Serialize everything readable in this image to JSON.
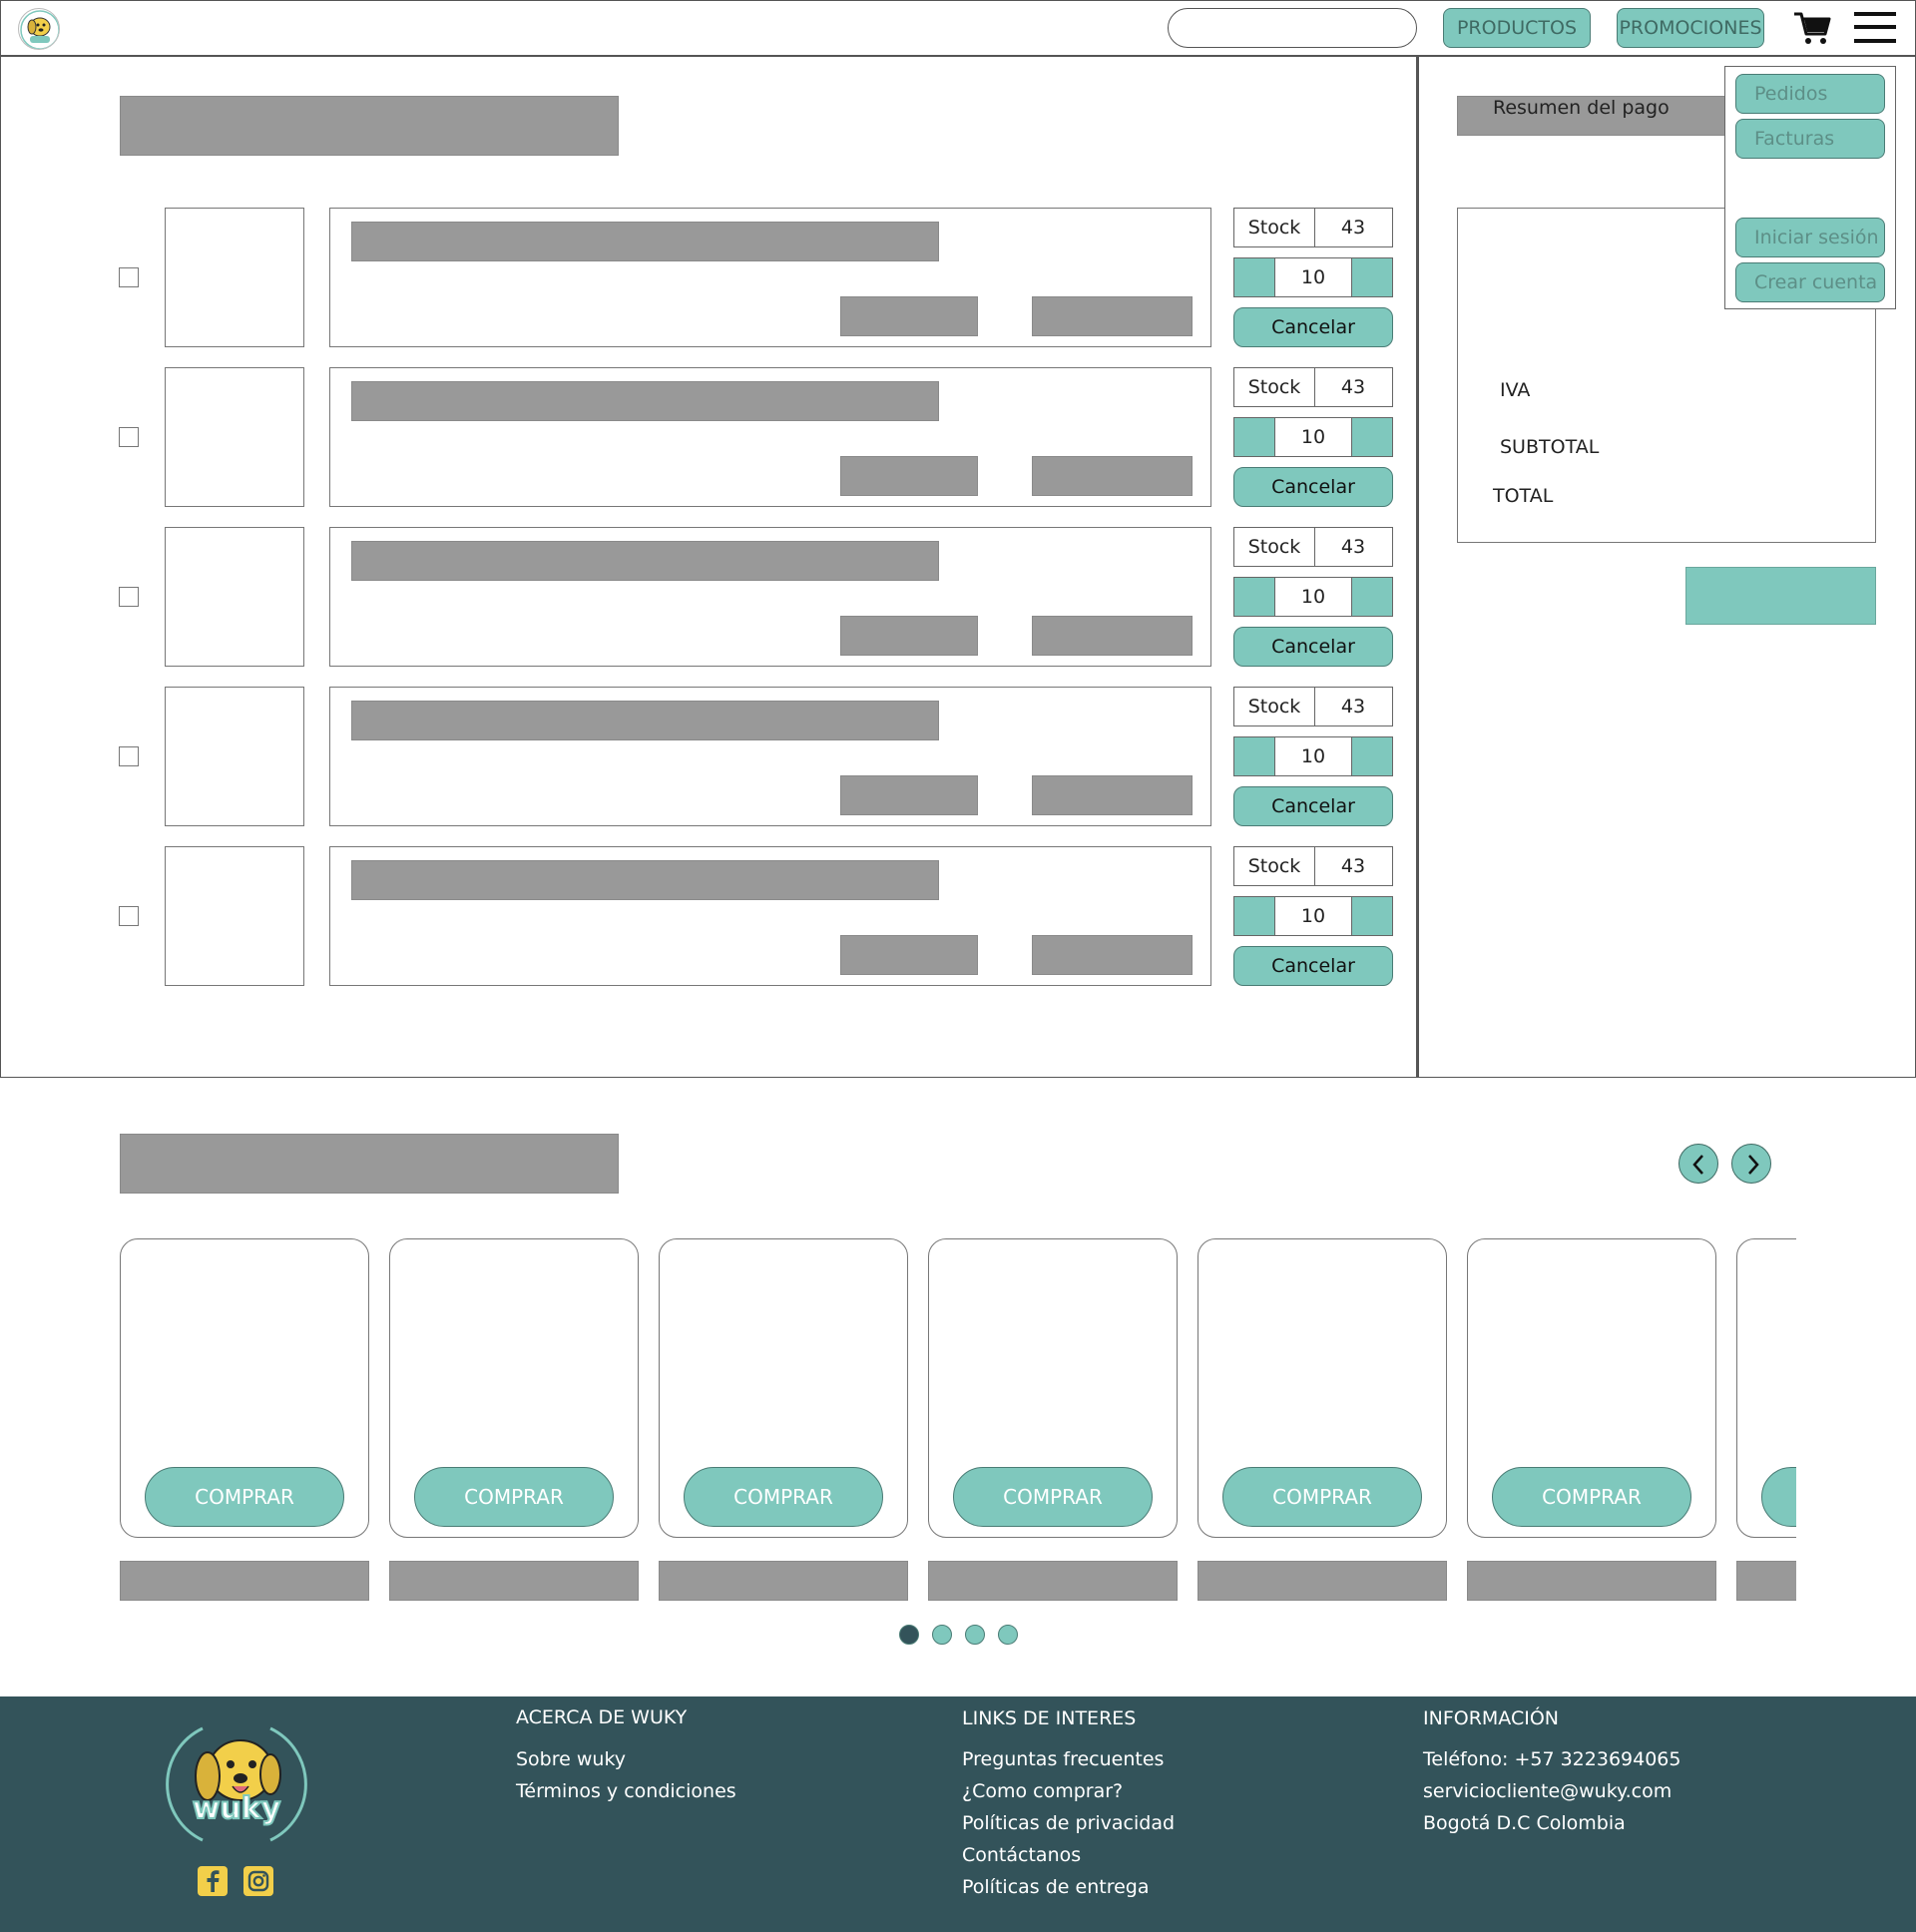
{
  "header": {
    "search_placeholder": "",
    "nav": [
      "PRODUCTOS",
      "PROMOCIONES"
    ],
    "cart_icon": "cart-icon",
    "menu_icon": "hamburger-menu-icon"
  },
  "dropdown_menu": {
    "items": [
      "Pedidos",
      "Facturas",
      "Iniciar sesión",
      "Crear cuenta"
    ]
  },
  "cart_items": [
    {
      "stock_label": "Stock",
      "stock_value": "43",
      "quantity": "10",
      "cancel_label": "Cancelar"
    },
    {
      "stock_label": "Stock",
      "stock_value": "43",
      "quantity": "10",
      "cancel_label": "Cancelar"
    },
    {
      "stock_label": "Stock",
      "stock_value": "43",
      "quantity": "10",
      "cancel_label": "Cancelar"
    },
    {
      "stock_label": "Stock",
      "stock_value": "43",
      "quantity": "10",
      "cancel_label": "Cancelar"
    },
    {
      "stock_label": "Stock",
      "stock_value": "43",
      "quantity": "10",
      "cancel_label": "Cancelar"
    }
  ],
  "summary": {
    "title": "Resumen del pago",
    "iva": "IVA",
    "subtotal": "SUBTOTAL",
    "total": "TOTAL",
    "pay_button_label": ""
  },
  "carousel": {
    "buy_label": "COMPRAR",
    "cards": 7,
    "prev_icon": "chevron-left-icon",
    "next_icon": "chevron-right-icon",
    "pages": 4,
    "active_page": 1
  },
  "footer": {
    "about": {
      "title": "ACERCA DE WUKY",
      "links": [
        "Sobre wuky",
        "Términos y condiciones"
      ]
    },
    "links": {
      "title": "LINKS DE INTERES",
      "links": [
        "Preguntas frecuentes",
        "¿Como comprar?",
        "Políticas de privacidad",
        "Contáctanos",
        "Políticas de entrega"
      ]
    },
    "info": {
      "title": "INFORMACIÓN",
      "lines": [
        "Teléfono: +57 3223694065",
        "serviciocliente@wuky.com",
        "Bogotá D.C Colombia"
      ]
    },
    "logo_text": "wuky",
    "social": [
      "facebook-icon",
      "instagram-icon"
    ]
  },
  "colors": {
    "accent": "#7fc8bd",
    "footer_bg": "#33535a",
    "placeholder_gray": "#999999",
    "active_dot": "#33535a"
  }
}
